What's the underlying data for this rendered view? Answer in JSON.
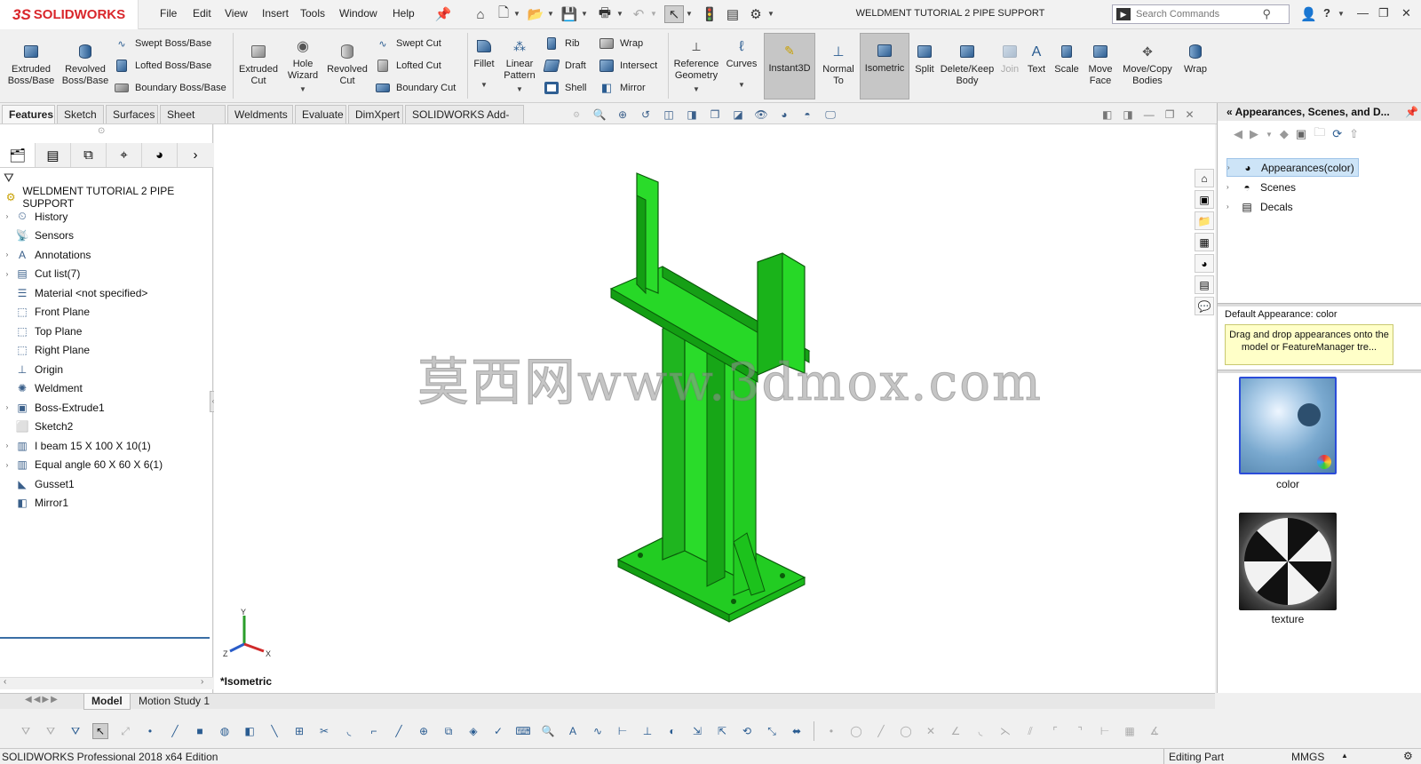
{
  "app": {
    "logo_text": "SOLIDWORKS"
  },
  "menu": [
    "File",
    "Edit",
    "View",
    "Insert",
    "Tools",
    "Window",
    "Help"
  ],
  "document_title": "WELDMENT TUTORIAL 2 PIPE SUPPORT",
  "search": {
    "placeholder": "Search Commands"
  },
  "ribbon": {
    "extruded_boss": "Extruded Boss/Base",
    "revolved_boss": "Revolved Boss/Base",
    "swept_boss": "Swept Boss/Base",
    "lofted_boss": "Lofted Boss/Base",
    "boundary_boss": "Boundary Boss/Base",
    "extruded_cut": "Extruded Cut",
    "hole_wizard": "Hole Wizard",
    "revolved_cut": "Revolved Cut",
    "swept_cut": "Swept Cut",
    "lofted_cut": "Lofted Cut",
    "boundary_cut": "Boundary Cut",
    "fillet": "Fillet",
    "linear_pattern": "Linear Pattern",
    "rib": "Rib",
    "draft": "Draft",
    "shell": "Shell",
    "wrap": "Wrap",
    "intersect": "Intersect",
    "mirror": "Mirror",
    "reference_geometry": "Reference Geometry",
    "curves": "Curves",
    "instant3d": "Instant3D",
    "normal_to": "Normal To",
    "isometric": "Isometric",
    "split": "Split",
    "delete_keep": "Delete/Keep Body",
    "join": "Join",
    "text": "Text",
    "scale": "Scale",
    "move_face": "Move Face",
    "move_copy": "Move/Copy Bodies",
    "wrap2": "Wrap"
  },
  "tabs": [
    "Features",
    "Sketch",
    "Surfaces",
    "Sheet Metal",
    "Weldments",
    "Evaluate",
    "DimXpert",
    "SOLIDWORKS Add-Ins"
  ],
  "tree": {
    "root": "WELDMENT TUTORIAL 2 PIPE SUPPORT",
    "items": [
      {
        "label": "History",
        "icon": "history-icon",
        "expandable": true
      },
      {
        "label": "Sensors",
        "icon": "sensors-icon",
        "expandable": false
      },
      {
        "label": "Annotations",
        "icon": "annotations-icon",
        "expandable": true
      },
      {
        "label": "Cut list(7)",
        "icon": "cut-list-icon",
        "expandable": true
      },
      {
        "label": "Material <not specified>",
        "icon": "material-icon",
        "expandable": false
      },
      {
        "label": "Front Plane",
        "icon": "plane-icon",
        "expandable": false
      },
      {
        "label": "Top Plane",
        "icon": "plane-icon",
        "expandable": false
      },
      {
        "label": "Right Plane",
        "icon": "plane-icon",
        "expandable": false
      },
      {
        "label": "Origin",
        "icon": "origin-icon",
        "expandable": false
      },
      {
        "label": "Weldment",
        "icon": "weldment-icon",
        "expandable": false
      },
      {
        "label": "Boss-Extrude1",
        "icon": "boss-extrude-icon",
        "expandable": true
      },
      {
        "label": "Sketch2",
        "icon": "sketch-icon",
        "expandable": false
      },
      {
        "label": "I beam 15 X 100 X 10(1)",
        "icon": "structural-member-icon",
        "expandable": true
      },
      {
        "label": "Equal angle 60 X 60 X 6(1)",
        "icon": "structural-member-icon",
        "expandable": true
      },
      {
        "label": "Gusset1",
        "icon": "gusset-icon",
        "expandable": false
      },
      {
        "label": "Mirror1",
        "icon": "mirror-icon",
        "expandable": false
      }
    ]
  },
  "viewport": {
    "view_label": "*Isometric",
    "watermark": "莫西网www.3dmox.com",
    "model_color": "#22cc22",
    "axes": {
      "x": "X",
      "y": "Y",
      "z": "Z"
    }
  },
  "task_pane": {
    "title": "Appearances, Scenes, and D...",
    "items": [
      {
        "label": "Appearances(color)",
        "selected": true
      },
      {
        "label": "Scenes",
        "selected": false
      },
      {
        "label": "Decals",
        "selected": false
      }
    ],
    "default_appearance": "Default Appearance: color",
    "tip": "Drag and drop appearances onto the model or FeatureManager tre...",
    "swatches": [
      {
        "label": "color"
      },
      {
        "label": "texture"
      }
    ]
  },
  "bottom_tabs": [
    "Model",
    "Motion Study 1"
  ],
  "status": {
    "edition": "SOLIDWORKS Professional 2018 x64 Edition",
    "mode": "Editing Part",
    "units": "MMGS"
  }
}
